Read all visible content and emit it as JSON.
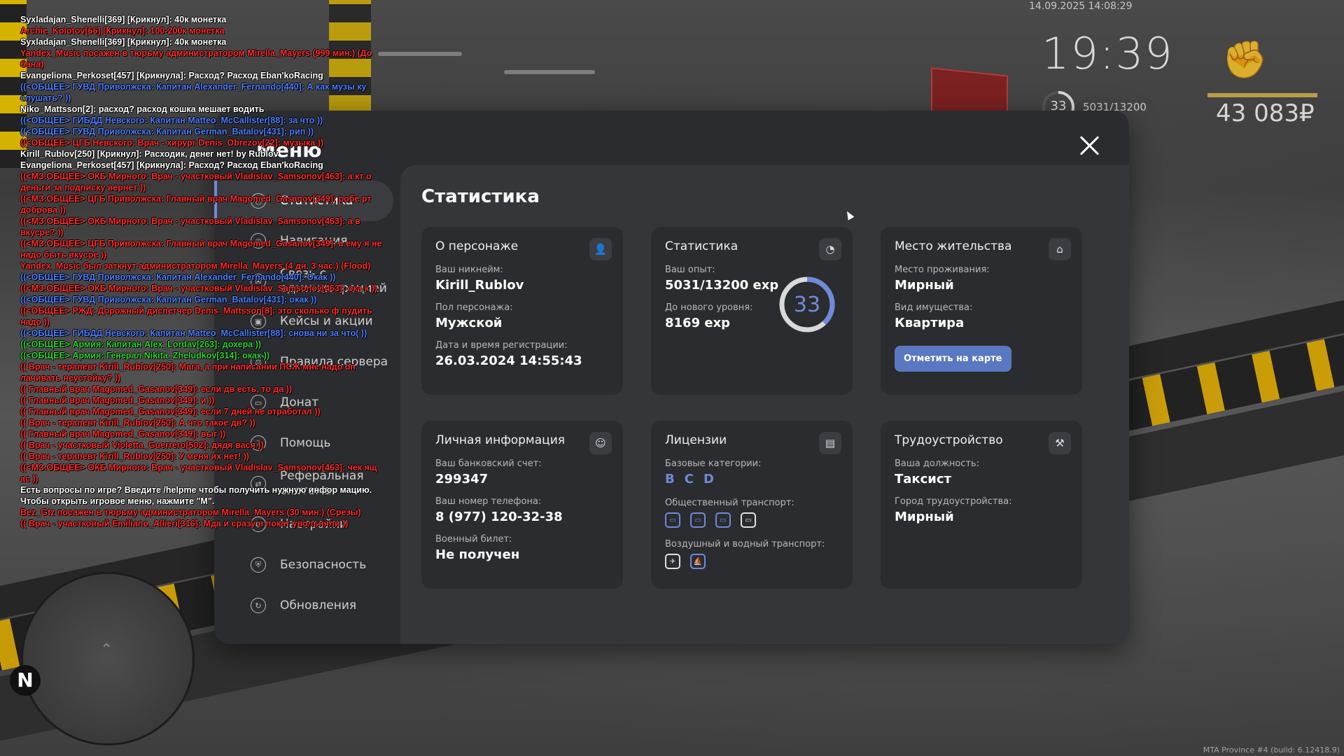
{
  "hud": {
    "datetime": "14.09.2025 14:08:29",
    "clock": "19:39",
    "level": "33",
    "exp": "5031/13200",
    "money": "43 083₽",
    "build": "MTA Province #4 (build: 6.12418.9)"
  },
  "radar": {
    "north": "N"
  },
  "chat": [
    {
      "text": "Syxladajan_Shenelli[369] [Крикнул]: 40к монетка",
      "color": "white"
    },
    {
      "text": "Archie_Kolotov[66] [Крикнул]: 100-200к монетка",
      "color": "red"
    },
    {
      "text": "Syxladajan_Shenelli[369] [Крикнул]: 40к монетка",
      "color": "white"
    },
    {
      "text": "Yandex_Music посажен в тюрьму администратором Mirella_Mayers (999 мин.) (До бана)",
      "color": "red"
    },
    {
      "text": "Evangeliona_Perkoset[457] [Крикнула]: Расход? Расход Eban'koRacing",
      "color": "white"
    },
    {
      "text": "((<ОБЩЕЕ> ГУВД Приволжска: Капитан Alexander_Fernando[440]: А как музы ку слушать? ))",
      "color": "blue"
    },
    {
      "text": "Niko_Mattsson[2]: расход? расход кошка мешает водить",
      "color": "white"
    },
    {
      "text": "((<ОБЩЕЕ> ГИБДД Невского: Капитан Matteo_McCallister[88]: за что ))",
      "color": "blue"
    },
    {
      "text": "((<ОБЩЕЕ> ГУВД Приволжска: Капитан German_Batalov[431]: рип ))",
      "color": "blue"
    },
    {
      "text": "((<ОБЩЕЕ> ЦГБ Невского: Врач - хирург Denis_Obrezov[22]: музыка ))",
      "color": "red"
    },
    {
      "text": "Kirill_Rublov[250] [Крикнул]: Расходик, денег нет! by Rublov",
      "color": "white"
    },
    {
      "text": "Evangeliona_Perkoset[457] [Крикнула]: Расход? Расход Eban'koRacing",
      "color": "white"
    },
    {
      "text": "((<МЗ.ОБЩЕЕ> ОКБ Мирного: Врач - участковый Vladislav_Samsonov[463]: а кт о деньги за подписку вернет ))",
      "color": "red"
    },
    {
      "text": "((<МЗ.ОБЩЕЕ> ЦГБ Приволжска: Главный врач Magomed_Gasanov[349]: робе рт доброва ))",
      "color": "red"
    },
    {
      "text": "((<МЗ.ОБЩЕЕ> ОКБ Мирного: Врач - участковый Vladislav_Samsonov[463]: а в вкусре? ))",
      "color": "red"
    },
    {
      "text": "((<МЗ.ОБЩЕЕ> ЦГБ Приволжска: Главный врач Magomed_Gasanov[349]: а ему я не надо быть вкусре ))",
      "color": "red"
    },
    {
      "text": "Yandex_Music был заткнут администратором Mirella_Mayers (4 дн. 3 час.) (Flood)",
      "color": "red"
    },
    {
      "text": "((<ОБЩЕЕ> ГУВД Приволжска: Капитан Alexander_Fernando[440]: Окак ))",
      "color": "blue"
    },
    {
      "text": "((<МЗ.ОБЩЕЕ> ОКБ Мирного: Врач - участковый Vladislav_Samsonov[463]: ока к ))",
      "color": "red"
    },
    {
      "text": "((<ОБЩЕЕ> ГУВД Приволжска: Капитан German_Batalov[431]: окак ))",
      "color": "blue"
    },
    {
      "text": "((<ОБЩЕЕ> РЖД: Дорожный диспетчер Denis_Mattsson[8]: это сколько ф пудить надо ))",
      "color": "red"
    },
    {
      "text": "((<ОБЩЕЕ> ГИБДД Невского: Капитан Matteo_McCallister[88]: снова ни за что( ))",
      "color": "blue"
    },
    {
      "text": "((<ОБЩЕЕ> Армия: Капитан Alex_Lordav[263]: дохера ))",
      "color": "green"
    },
    {
      "text": "((<ОБЩЕЕ> Армия: Генерал Nikita_Zheludkov[314]: окак ))",
      "color": "green"
    },
    {
      "text": "(( Врач - терапевт Kirill_Rublov[250]: Мага, а при написании ПСЖ мне надо оп лачивать неустойку? ))",
      "color": "red"
    },
    {
      "text": "(( Главный врач Magomed_Gasanov[349]: если дв есть, то да ))",
      "color": "red"
    },
    {
      "text": "(( Главный врач Magomed_Gasanov[349]: и ))",
      "color": "red"
    },
    {
      "text": "(( Главный врач Magomed_Gasanov[349]: если 7 дней не отработал ))",
      "color": "red"
    },
    {
      "text": "(( Врач - терапевт Kirill_Rublov[250]: А что такое дв? ))",
      "color": "red"
    },
    {
      "text": "(( Главный врач Magomed_Gasanov[349]: выг ))",
      "color": "red"
    },
    {
      "text": "(( Врач - участковый Violetta_Guerrero[502]: дядя вася ))",
      "color": "red"
    },
    {
      "text": "(( Врач - терапевт Kirill_Rublov[250]: У меня их нет! ))",
      "color": "red"
    },
    {
      "text": "((<МЗ.ОБЩЕЕ> ОКБ Мирного: Врач - участковый Vladislav_Samsonov[463]: чек ящ ас ))",
      "color": "red"
    },
    {
      "text": "Есть вопросы по игре? Введите /helpme чтобы получить нужную инфор мацию.",
      "color": "white"
    },
    {
      "text": "Чтобы открыть игровое меню, нажмите \"M\".",
      "color": "white"
    },
    {
      "text": "Bez_Gtz посажен в тюрьму администратором Mirella_Mayers (30 мин.) (Срезы)",
      "color": "red"
    },
    {
      "text": "(( Врач - участковый Emiliano_Allieri[316]: Мда и сразу в покат увольняли ))",
      "color": "red"
    }
  ],
  "menu": {
    "title": "Меню",
    "items": [
      {
        "label": "Статистика",
        "icon": "chart-icon"
      },
      {
        "label": "Навигация",
        "icon": "compass-icon"
      },
      {
        "label": "Связь с администрацией",
        "icon": "chat-icon"
      },
      {
        "label": "Кейсы и акции",
        "icon": "gift-icon"
      },
      {
        "label": "Правила сервера",
        "icon": "scales-icon"
      },
      {
        "label": "Донат",
        "icon": "wallet-icon"
      },
      {
        "label": "Помощь",
        "icon": "help-icon"
      },
      {
        "label": "Реферальная система",
        "icon": "referral-icon"
      },
      {
        "label": "Настройки",
        "icon": "gear-icon"
      },
      {
        "label": "Безопасность",
        "icon": "shield-icon"
      },
      {
        "label": "Обновления",
        "icon": "refresh-icon"
      }
    ]
  },
  "content": {
    "title": "Статистика",
    "character": {
      "head": "О персонаже",
      "nick_label": "Ваш никнейм:",
      "nick": "Kirill_Rublov",
      "sex_label": "Пол персонажа:",
      "sex": "Мужской",
      "reg_label": "Дата и время регистрации:",
      "reg": "26.03.2024 14:55:43"
    },
    "stats": {
      "head": "Статистика",
      "exp_label": "Ваш опыт:",
      "exp": "5031/13200 exp",
      "next_label": "До нового уровня:",
      "next": "8169 exp",
      "level": "33",
      "progress": 0.381
    },
    "residence": {
      "head": "Место жительства",
      "place_label": "Место проживания:",
      "place": "Мирный",
      "type_label": "Вид имущества:",
      "type": "Квартира",
      "button": "Отметить на карте"
    },
    "personal": {
      "head": "Личная информация",
      "bank_label": "Ваш банковский счет:",
      "bank": "299347",
      "phone_label": "Ваш номер телефона:",
      "phone": "8 (977) 120-32-38",
      "military_label": "Военный билет:",
      "military": "Не получен"
    },
    "licenses": {
      "head": "Лицензии",
      "base_label": "Базовые категории:",
      "base": [
        "B",
        "C",
        "D"
      ],
      "public_label": "Общественный транспорт:",
      "air_label": "Воздушный и водный транспорт:"
    },
    "job": {
      "head": "Трудоустройство",
      "pos_label": "Ваша должность:",
      "pos": "Таксист",
      "city_label": "Город трудоустройства:",
      "city": "Мирный"
    }
  },
  "colors": {
    "accent": "#6f8ad8",
    "button": "#5a78c2"
  }
}
